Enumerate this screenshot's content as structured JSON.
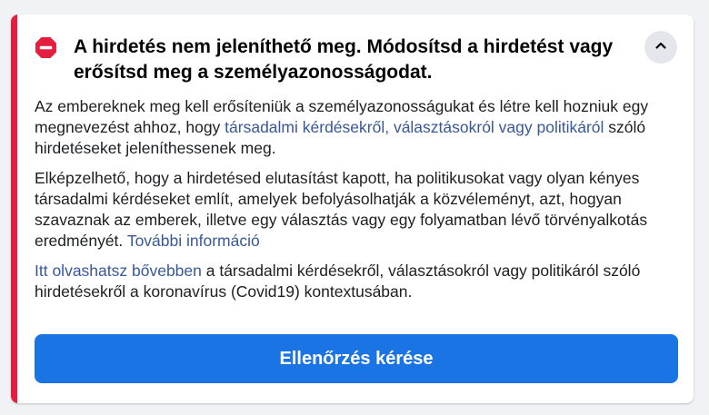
{
  "notice": {
    "title": "A hirdetés nem jeleníthető meg. Módosítsd a hirdetést vagy erősítsd meg a személyazonosságodat.",
    "icon": "stop-icon",
    "collapse_icon": "chevron-up-icon",
    "accent_color": "#e41e3f",
    "paragraph1": {
      "text_before": "Az embereknek meg kell erősíteniük a személyazonosságukat és létre kell hozniuk egy megnevezést ahhoz, hogy ",
      "link": "társadalmi kérdésekről, választásokról vagy politikáról",
      "text_after": " szóló hirdetéseket jeleníthessenek meg."
    },
    "paragraph2": {
      "text_before": "Elképzelhető, hogy a hirdetésed elutasítást kapott, ha politikusokat vagy olyan kényes társadalmi kérdéseket említ, amelyek befolyásolhatják a közvéleményt, azt, hogyan szavaznak az emberek, illetve egy választás vagy egy folyamatban lévő törvényalkotás eredményét. ",
      "link": "További információ"
    },
    "paragraph3": {
      "link": "Itt olvashatsz bővebben",
      "text_after": " a társadalmi kérdésekről, választásokról vagy politikáról szóló hirdetésekről a koronavírus (Covid19) kontextusában."
    },
    "button_label": "Ellenőrzés kérése",
    "button_color": "#1b74e4",
    "link_color": "#385898"
  }
}
